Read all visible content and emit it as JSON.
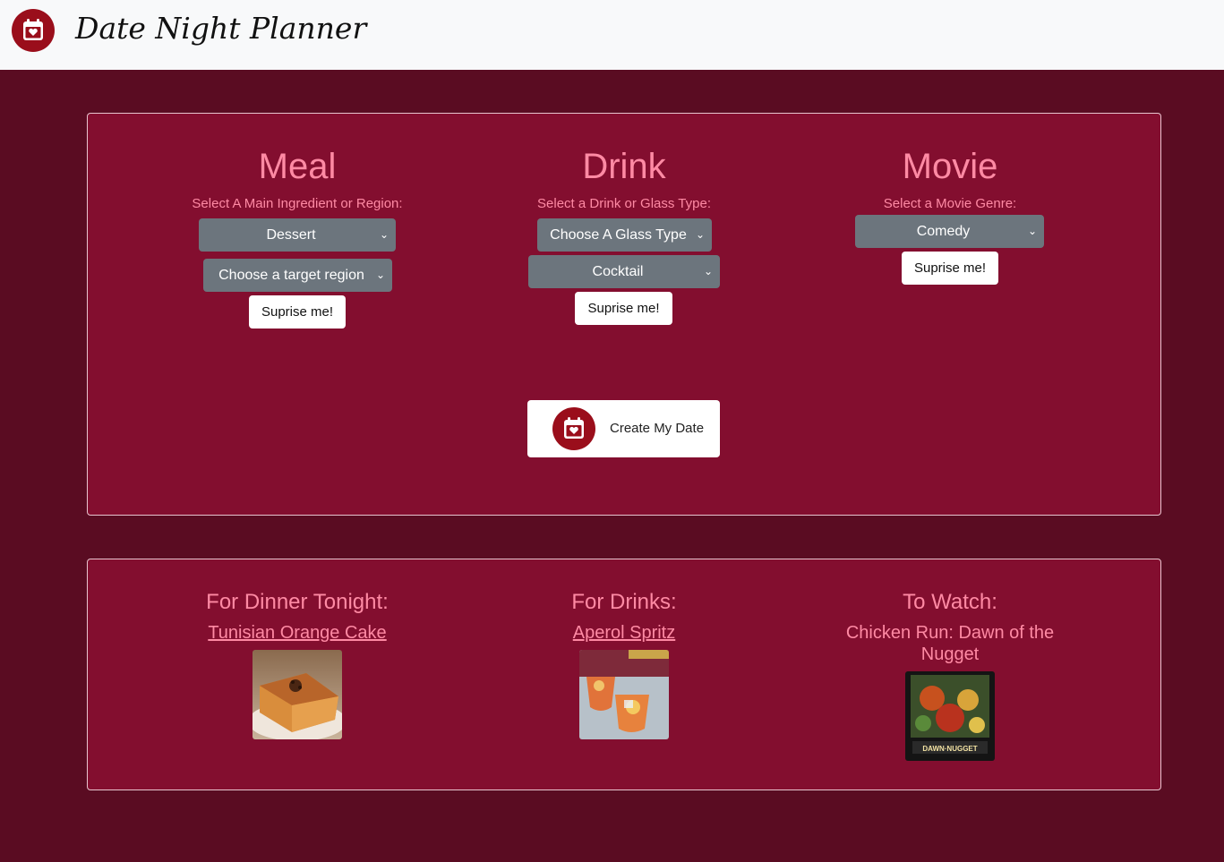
{
  "navbar": {
    "brand": "Date Night Planner",
    "logo_icon": "calendar-heart-icon",
    "logo_color": "#9a0e1b"
  },
  "colors": {
    "page_background": "#5a0c22",
    "card_background": "#830e2f",
    "accent_text": "#ff8aa4",
    "select_background": "#6c757d"
  },
  "meal": {
    "title": "Meal",
    "label": "Select A Main Ingredient or Region:",
    "ingredient_select": "Dessert",
    "region_select": "Choose a target region",
    "surprise_button": "Suprise me!"
  },
  "drink": {
    "title": "Drink",
    "label": "Select a Drink or Glass Type:",
    "glass_select": "Choose A Glass Type",
    "drink_select": "Cocktail",
    "surprise_button": "Suprise me!"
  },
  "movie": {
    "title": "Movie",
    "label": "Select a Movie Genre:",
    "genre_select": "Comedy",
    "surprise_button": "Suprise me!"
  },
  "create_button": {
    "label": "Create My Date",
    "icon": "calendar-heart-icon"
  },
  "results": {
    "dinner": {
      "heading": "For Dinner Tonight:",
      "name": "Tunisian Orange Cake"
    },
    "drinks": {
      "heading": "For Drinks:",
      "name": "Aperol Spritz"
    },
    "watch": {
      "heading": "To Watch:",
      "name": "Chicken Run: Dawn of the Nugget",
      "poster_text": "DAWN·NUGGET"
    }
  }
}
